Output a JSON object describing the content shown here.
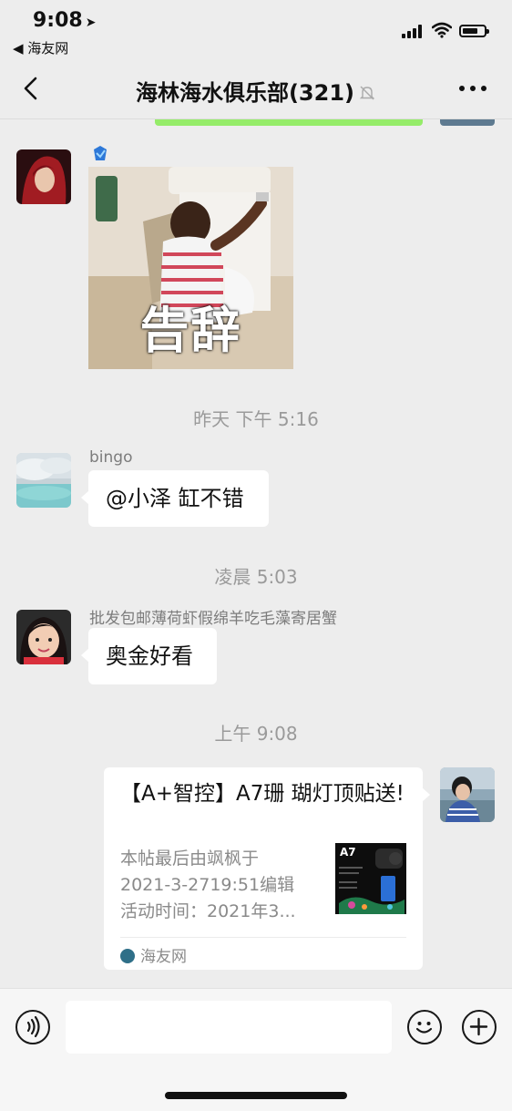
{
  "status_bar": {
    "time": "9:08",
    "back_app": "◀ 海友网"
  },
  "nav": {
    "title": "海林海水俱乐部(321)",
    "icons": [
      "back-chevron-icon",
      "mute-bell-icon",
      "more-icon"
    ]
  },
  "messages": {
    "sticker_text": "告辞",
    "ts1": "昨天 下午 5:16",
    "m2_sender": "bingo",
    "m2_text": "@小泽 缸不错",
    "ts2": "凌晨 5:03",
    "m3_sender": "批发包邮薄荷虾假绵羊吃毛藻寄居蟹",
    "m3_text": "奥金好看",
    "ts3": "上午 9:08"
  },
  "card": {
    "title": "【A+智控】A7珊 瑚灯顶贴送!",
    "desc_line1": "本帖最后由飒枫于",
    "desc_line2": "2021-3-2719:51编辑",
    "desc_line3": "活动时间：2021年3...",
    "thumb_label": "A7",
    "source": "海友网"
  },
  "inputbar": {
    "value": "",
    "icons": [
      "voice-icon",
      "emoji-icon",
      "plus-icon"
    ]
  },
  "colors": {
    "background": "#ededed",
    "sent_bubble": "#95ec69",
    "received_bubble": "#ffffff",
    "timestamp": "#9a9a9a"
  }
}
